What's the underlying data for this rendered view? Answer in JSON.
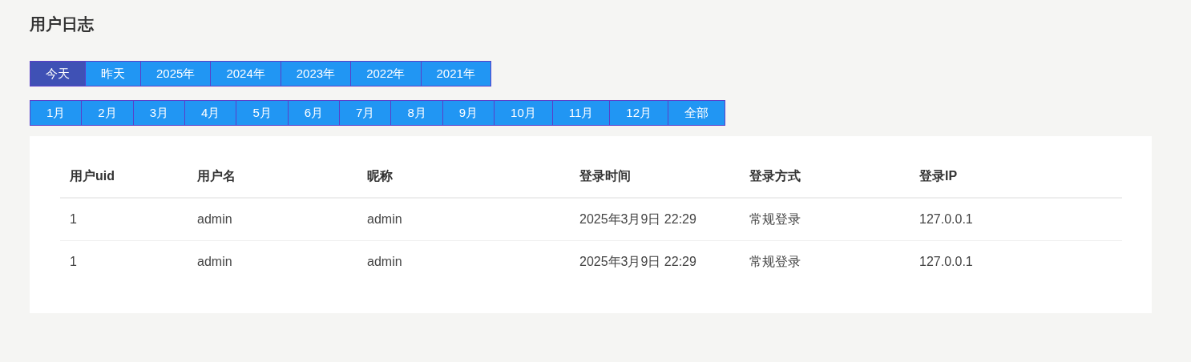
{
  "title": "用户日志",
  "year_tabs": [
    {
      "label": "今天",
      "selected": true
    },
    {
      "label": "昨天",
      "selected": false
    },
    {
      "label": "2025年",
      "selected": false
    },
    {
      "label": "2024年",
      "selected": false
    },
    {
      "label": "2023年",
      "selected": false
    },
    {
      "label": "2022年",
      "selected": false
    },
    {
      "label": "2021年",
      "selected": false
    }
  ],
  "month_tabs": [
    {
      "label": "1月",
      "selected": false
    },
    {
      "label": "2月",
      "selected": false
    },
    {
      "label": "3月",
      "selected": false
    },
    {
      "label": "4月",
      "selected": false
    },
    {
      "label": "5月",
      "selected": false
    },
    {
      "label": "6月",
      "selected": false
    },
    {
      "label": "7月",
      "selected": false
    },
    {
      "label": "8月",
      "selected": false
    },
    {
      "label": "9月",
      "selected": false
    },
    {
      "label": "10月",
      "selected": false
    },
    {
      "label": "11月",
      "selected": false
    },
    {
      "label": "12月",
      "selected": false
    },
    {
      "label": "全部",
      "selected": false
    }
  ],
  "table": {
    "columns": [
      "用户uid",
      "用户名",
      "昵称",
      "登录时间",
      "登录方式",
      "登录IP"
    ],
    "rows": [
      [
        "1",
        "admin",
        "admin",
        "2025年3月9日 22:29",
        "常规登录",
        "127.0.0.1"
      ],
      [
        "1",
        "admin",
        "admin",
        "2025年3月9日 22:29",
        "常规登录",
        "127.0.0.1"
      ]
    ]
  }
}
